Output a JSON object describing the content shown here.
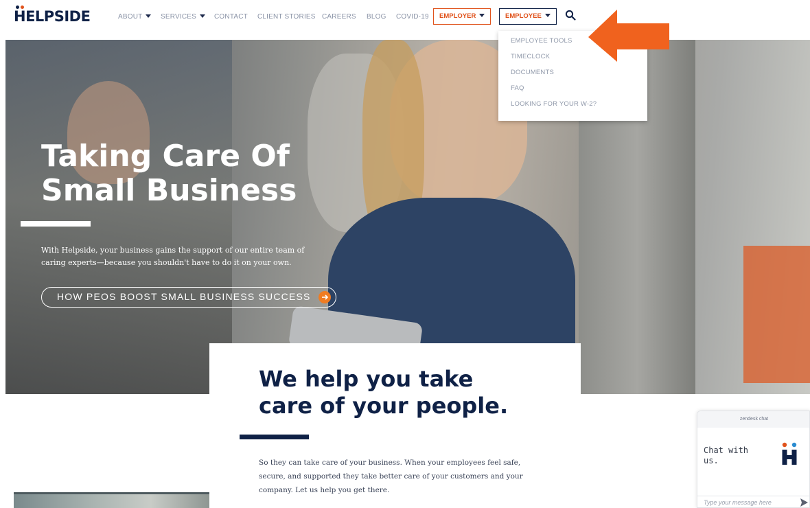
{
  "brand": {
    "name": "HELPSIDE",
    "dot_left": "#0f2146",
    "dot_right": "#e0531c"
  },
  "nav": {
    "items": [
      {
        "label": "ABOUT"
      },
      {
        "label": "SERVICES"
      },
      {
        "label": "CONTACT"
      },
      {
        "label": "CLIENT STORIES"
      },
      {
        "label": "CAREERS"
      },
      {
        "label": "BLOG"
      },
      {
        "label": "COVID-19"
      }
    ],
    "employer_label": "EMPLOYER",
    "employee_label": "EMPLOYEE",
    "search_icon": "magnifier-icon"
  },
  "dropdown": {
    "items": [
      {
        "label": "EMPLOYEE TOOLS"
      },
      {
        "label": "TIMECLOCK"
      },
      {
        "label": "DOCUMENTS"
      },
      {
        "label": "FAQ"
      },
      {
        "label": "LOOKING FOR YOUR W-2?"
      }
    ]
  },
  "hero": {
    "title_line1": "Taking Care Of",
    "title_line2": "Small Business",
    "description": "With Helpside, your business gains the support of our entire team of caring experts—because you shouldn't have to do it on your own.",
    "cta_label": "HOW PEOS BOOST SMALL BUSINESS SUCCESS"
  },
  "content": {
    "title_line1": "We help you take",
    "title_line2": "care of your people.",
    "body": "So they can take care of your business. When your employees feel safe, secure, and supported they take better care of your customers and your company. Let us help you get there."
  },
  "chat": {
    "header": "zendesk chat",
    "greeting": "Chat with us.",
    "input_placeholder": "Type your message here"
  },
  "colors": {
    "accent": "#e0531c",
    "navy": "#0f2146",
    "cta_orange": "#f07c22"
  }
}
